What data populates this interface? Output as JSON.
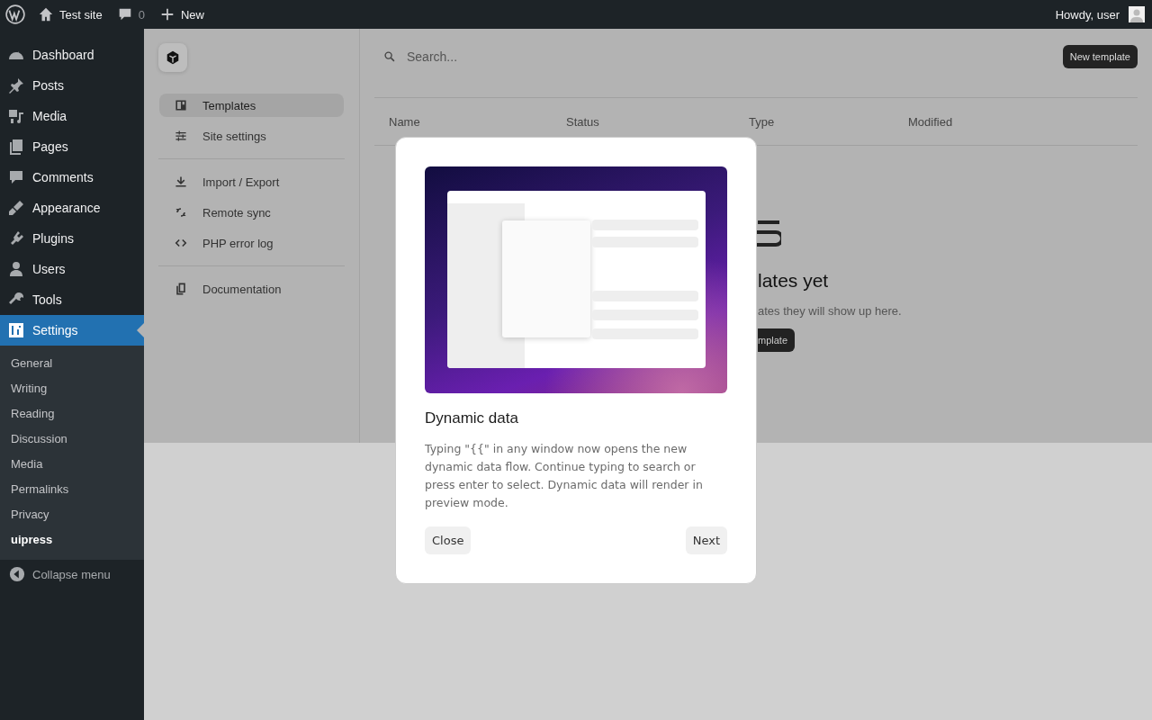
{
  "admin_bar": {
    "site_name": "Test site",
    "comments_count": "0",
    "new_label": "New",
    "greeting": "Howdy, user"
  },
  "sidebar": {
    "items": [
      {
        "label": "Dashboard",
        "selected": false
      },
      {
        "label": "Posts",
        "selected": false
      },
      {
        "label": "Media",
        "selected": false
      },
      {
        "label": "Pages",
        "selected": false
      },
      {
        "label": "Comments",
        "selected": false
      },
      {
        "label": "Appearance",
        "selected": false
      },
      {
        "label": "Plugins",
        "selected": false
      },
      {
        "label": "Users",
        "selected": false
      },
      {
        "label": "Tools",
        "selected": false
      },
      {
        "label": "Settings",
        "selected": true
      }
    ],
    "submenu": [
      {
        "label": "General",
        "selected": false
      },
      {
        "label": "Writing",
        "selected": false
      },
      {
        "label": "Reading",
        "selected": false
      },
      {
        "label": "Discussion",
        "selected": false
      },
      {
        "label": "Media",
        "selected": false
      },
      {
        "label": "Permalinks",
        "selected": false
      },
      {
        "label": "Privacy",
        "selected": false
      },
      {
        "label": "uipress",
        "selected": true
      }
    ],
    "collapse_label": "Collapse menu"
  },
  "app_nav": {
    "groups": [
      [
        {
          "label": "Templates",
          "selected": true
        },
        {
          "label": "Site settings",
          "selected": false
        }
      ],
      [
        {
          "label": "Import / Export",
          "selected": false
        },
        {
          "label": "Remote sync",
          "selected": false
        },
        {
          "label": "PHP error log",
          "selected": false
        }
      ],
      [
        {
          "label": "Documentation",
          "selected": false
        }
      ]
    ]
  },
  "main": {
    "search": {
      "placeholder": "Search..."
    },
    "new_button": "New template",
    "columns": [
      "Name",
      "Status",
      "Type",
      "Modified"
    ],
    "empty_title": "lates yet",
    "empty_text": "ates they will show up here.",
    "empty_button": "mplate"
  },
  "modal": {
    "title": "Dynamic data",
    "text": "Typing \"{{\" in any window now opens the new dynamic data flow. Continue typing to search or press enter to select. Dynamic data will render in preview mode.",
    "buttons": [
      "Close",
      "Next"
    ]
  }
}
